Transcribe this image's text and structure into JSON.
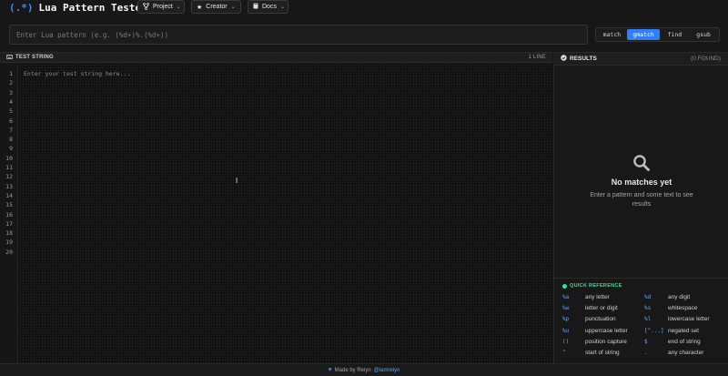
{
  "header": {
    "logo_glyph": "(.*)",
    "title": "Lua Pattern Tester",
    "nav": [
      {
        "label": "Project",
        "icon": "git-fork-icon"
      },
      {
        "label": "Creator",
        "icon": "star-icon"
      },
      {
        "label": "Docs",
        "icon": "book-icon"
      }
    ]
  },
  "pattern": {
    "value": "",
    "placeholder": "Enter Lua pattern (e.g. (%d+)%.(%d+))"
  },
  "modes": [
    {
      "label": "match",
      "active": false
    },
    {
      "label": "gmatch",
      "active": true
    },
    {
      "label": "find",
      "active": false
    },
    {
      "label": "gsub",
      "active": false
    }
  ],
  "editor": {
    "header_label": "TEST STRING",
    "line_count_label": "1 LINE",
    "placeholder": "Enter your test string here...",
    "line_numbers": [
      "1",
      "2",
      "3",
      "4",
      "5",
      "6",
      "7",
      "8",
      "9",
      "10",
      "11",
      "12",
      "13",
      "14",
      "15",
      "16",
      "17",
      "18",
      "19",
      "20"
    ]
  },
  "results": {
    "header_label": "RESULTS",
    "found_label": "(0 FOUND)",
    "empty_title": "No matches yet",
    "empty_subtitle": "Enter a pattern and some text to see results"
  },
  "quick_reference": {
    "title": "QUICK REFERENCE",
    "items": [
      {
        "code": "%a",
        "desc": "any letter"
      },
      {
        "code": "%d",
        "desc": "any digit"
      },
      {
        "code": "%w",
        "desc": "letter or digit"
      },
      {
        "code": "%s",
        "desc": "whitespace"
      },
      {
        "code": "%p",
        "desc": "punctuation"
      },
      {
        "code": "%l",
        "desc": "lowercase letter"
      },
      {
        "code": "%u",
        "desc": "uppercase letter"
      },
      {
        "code": "[^...]",
        "desc": "negated set"
      },
      {
        "code": "()",
        "desc": "position capture"
      },
      {
        "code": "$",
        "desc": "end of string"
      },
      {
        "code": "^",
        "desc": "start of string"
      },
      {
        "code": ".",
        "desc": "any character"
      }
    ]
  },
  "footer": {
    "made_by": "Made by Reiyn",
    "handle": "@iamreiyn"
  },
  "colors": {
    "accent": "#2f7ef6",
    "quickref_green": "#3ddc97",
    "code_blue": "#60a5fa"
  }
}
